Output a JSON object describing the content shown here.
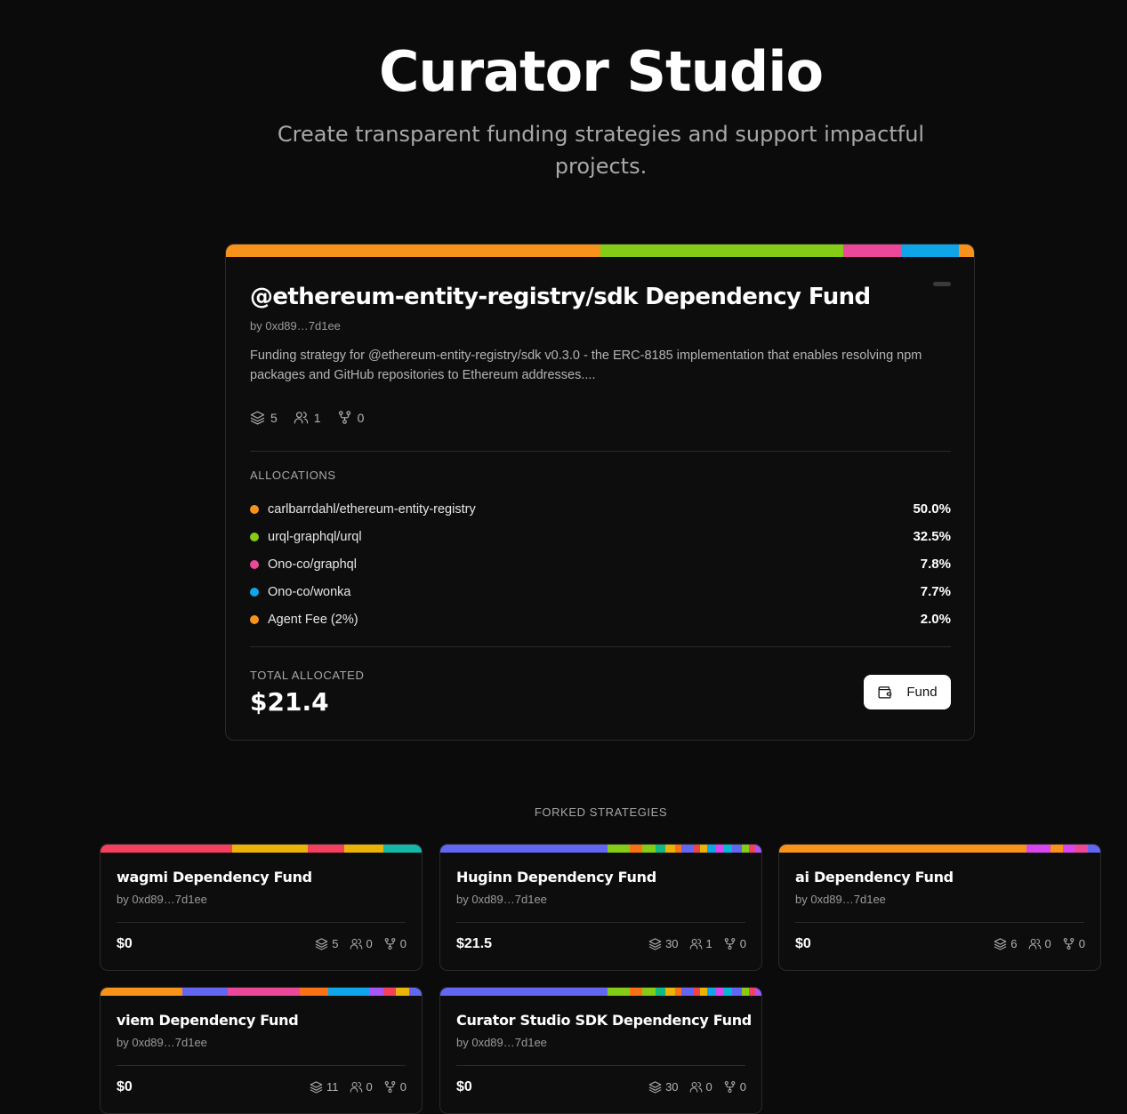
{
  "hero": {
    "title": "Curator Studio",
    "subtitle": "Create transparent funding strategies and support impactful projects."
  },
  "main": {
    "title": "@ethereum-entity-registry/sdk Dependency Fund",
    "by": "by 0xd89…7d1ee",
    "description": "Funding strategy for @ethereum-entity-registry/sdk v0.3.0 - the ERC-8185 implementation that enables resolving npm packages and GitHub repositories to Ethereum addresses....",
    "stats": {
      "projects": "5",
      "curators": "1",
      "forks": "0"
    },
    "allocations_label": "ALLOCATIONS",
    "allocations": [
      {
        "name": "carlbarrdahl/ethereum-entity-registry",
        "pct": "50.0%",
        "color": "#f7931a"
      },
      {
        "name": "urql-graphql/urql",
        "pct": "32.5%",
        "color": "#84cc16"
      },
      {
        "name": "Ono-co/graphql",
        "pct": "7.8%",
        "color": "#ec4899"
      },
      {
        "name": "Ono-co/wonka",
        "pct": "7.7%",
        "color": "#0ea5e9"
      },
      {
        "name": "Agent Fee (2%)",
        "pct": "2.0%",
        "color": "#f7931a"
      }
    ],
    "total_label": "TOTAL ALLOCATED",
    "total_value": "$21.4",
    "fund_label": "Fund"
  },
  "forked": {
    "label": "FORKED STRATEGIES",
    "cards": [
      {
        "title": "wagmi Dependency Fund",
        "by": "by 0xd89…7d1ee",
        "amount": "$0",
        "projects": "5",
        "curators": "0",
        "forks": "0"
      },
      {
        "title": "Huginn Dependency Fund",
        "by": "by 0xd89…7d1ee",
        "amount": "$21.5",
        "projects": "30",
        "curators": "1",
        "forks": "0"
      },
      {
        "title": "ai Dependency Fund",
        "by": "by 0xd89…7d1ee",
        "amount": "$0",
        "projects": "6",
        "curators": "0",
        "forks": "0"
      },
      {
        "title": "viem Dependency Fund",
        "by": "by 0xd89…7d1ee",
        "amount": "$0",
        "projects": "11",
        "curators": "0",
        "forks": "0"
      },
      {
        "title": "Curator Studio SDK Dependency Fund",
        "by": "by 0xd89…7d1ee",
        "amount": "$0",
        "projects": "30",
        "curators": "0",
        "forks": "0"
      }
    ]
  }
}
